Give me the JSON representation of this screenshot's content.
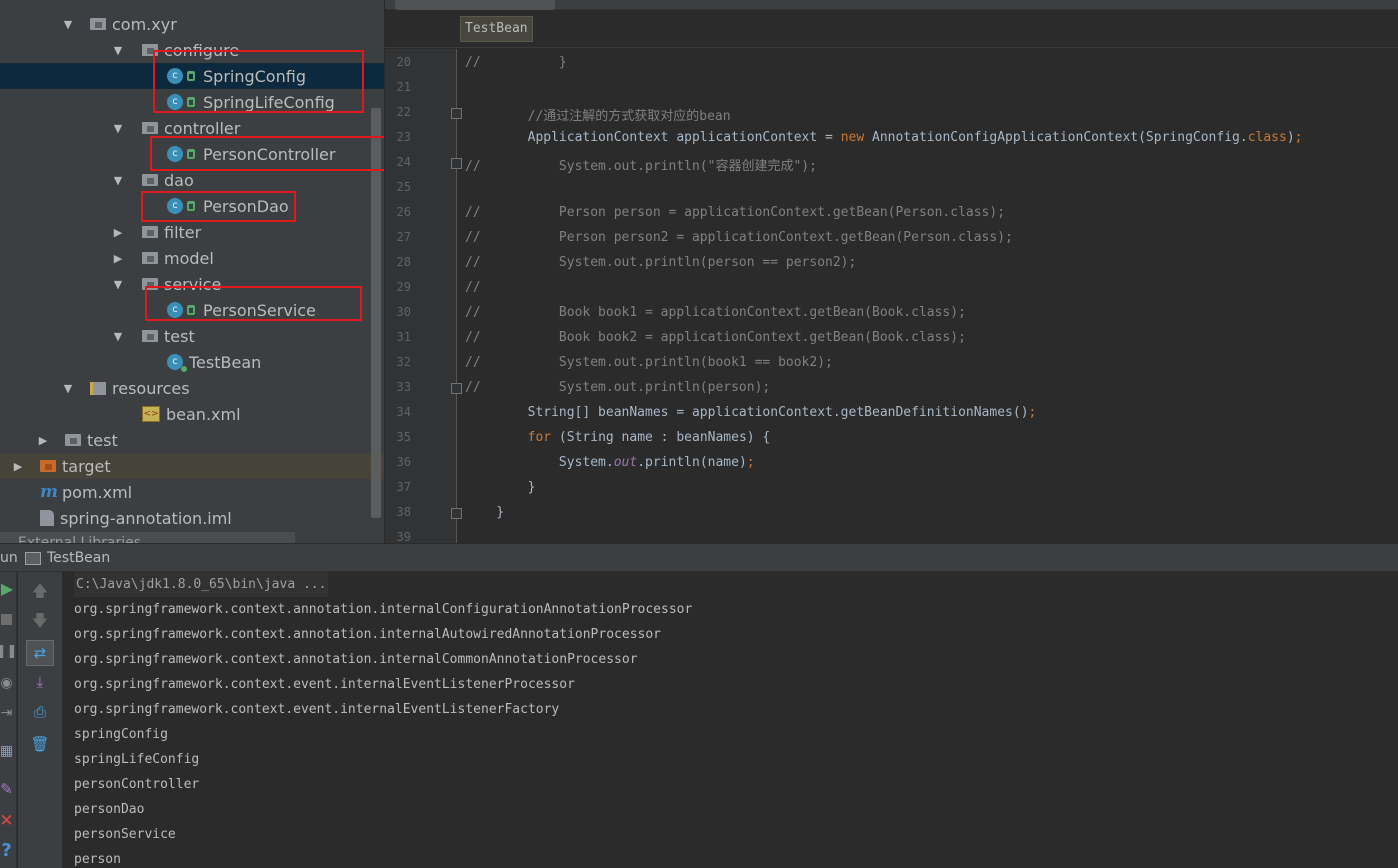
{
  "tree": [
    {
      "label": "com.xyr",
      "icon": "folder",
      "arrow": "▼",
      "indent": 1
    },
    {
      "label": "configure",
      "icon": "folder",
      "arrow": "▼",
      "indent": 2
    },
    {
      "label": "SpringConfig",
      "icon": "class",
      "arrow": "",
      "indent": 3,
      "selected": true
    },
    {
      "label": "SpringLifeConfig",
      "icon": "class",
      "arrow": "",
      "indent": 3
    },
    {
      "label": "controller",
      "icon": "folder",
      "arrow": "▼",
      "indent": 2
    },
    {
      "label": "PersonController",
      "icon": "class",
      "arrow": "",
      "indent": 3
    },
    {
      "label": "dao",
      "icon": "folder",
      "arrow": "▼",
      "indent": 2
    },
    {
      "label": "PersonDao",
      "icon": "class",
      "arrow": "",
      "indent": 3
    },
    {
      "label": "filter",
      "icon": "folder",
      "arrow": "▶",
      "indent": 2
    },
    {
      "label": "model",
      "icon": "folder",
      "arrow": "▶",
      "indent": 2
    },
    {
      "label": "service",
      "icon": "folder",
      "arrow": "▼",
      "indent": 2
    },
    {
      "label": "PersonService",
      "icon": "class",
      "arrow": "",
      "indent": 3
    },
    {
      "label": "test",
      "icon": "folder",
      "arrow": "▼",
      "indent": 2
    },
    {
      "label": "TestBean",
      "icon": "class-run",
      "arrow": "",
      "indent": 3
    },
    {
      "label": "resources",
      "icon": "resources",
      "arrow": "▼",
      "indent": 1
    },
    {
      "label": "bean.xml",
      "icon": "xml",
      "arrow": "",
      "indent": 2
    },
    {
      "label": "test",
      "icon": "folder",
      "arrow": "▶",
      "indent": 0
    },
    {
      "label": "target",
      "icon": "folder-orange",
      "arrow": "▶",
      "indent": -1,
      "alt": true
    },
    {
      "label": "pom.xml",
      "icon": "maven",
      "arrow": "",
      "indent": -1
    },
    {
      "label": "spring-annotation.iml",
      "icon": "iml",
      "arrow": "",
      "indent": -1
    }
  ],
  "external_libraries": "External Libraries",
  "breadcrumb": "TestBean",
  "line_numbers": [
    "20",
    "21",
    "22",
    "23",
    "24",
    "25",
    "26",
    "27",
    "28",
    "29",
    "30",
    "31",
    "32",
    "33",
    "34",
    "35",
    "36",
    "37",
    "38",
    "39"
  ],
  "code": [
    [
      {
        "t": "//          }",
        "c": "cm"
      }
    ],
    [],
    [
      {
        "t": "        //通过注解的方式获取对应的bean",
        "c": "cm"
      }
    ],
    [
      {
        "t": "        ApplicationContext applicationContext = "
      },
      {
        "t": "new",
        "c": "kw"
      },
      {
        "t": " AnnotationConfigApplicationContext(SpringConfig."
      },
      {
        "t": "class",
        "c": "kw"
      },
      {
        "t": ")"
      },
      {
        "t": ";",
        "c": "kw"
      }
    ],
    [
      {
        "t": "//          System.out.println(\"容器创建完成\");",
        "c": "cm"
      }
    ],
    [],
    [
      {
        "t": "//          Person person = applicationContext.getBean(Person.class);",
        "c": "cm"
      }
    ],
    [
      {
        "t": "//          Person person2 = applicationContext.getBean(Person.class);",
        "c": "cm"
      }
    ],
    [
      {
        "t": "//          System.out.println(person == person2);",
        "c": "cm"
      }
    ],
    [
      {
        "t": "//",
        "c": "cm"
      }
    ],
    [
      {
        "t": "//          Book book1 = applicationContext.getBean(Book.class);",
        "c": "cm"
      }
    ],
    [
      {
        "t": "//          Book book2 = applicationContext.getBean(Book.class);",
        "c": "cm"
      }
    ],
    [
      {
        "t": "//          System.out.println(book1 == book2);",
        "c": "cm"
      }
    ],
    [
      {
        "t": "//          System.out.println(person);",
        "c": "cm"
      }
    ],
    [
      {
        "t": "        String[] beanNames = applicationContext.getBeanDefinitionNames()"
      },
      {
        "t": ";",
        "c": "kw"
      }
    ],
    [
      {
        "t": "        "
      },
      {
        "t": "for",
        "c": "kw"
      },
      {
        "t": " (String name : beanNames) {"
      }
    ],
    [
      {
        "t": "            System."
      },
      {
        "t": "out",
        "c": "fld"
      },
      {
        "t": ".println(name)"
      },
      {
        "t": ";",
        "c": "kw"
      }
    ],
    [
      {
        "t": "        }"
      }
    ],
    [
      {
        "t": "    }"
      }
    ],
    []
  ],
  "run": {
    "label": "un",
    "tab": "TestBean",
    "output": [
      "C:\\Java\\jdk1.8.0_65\\bin\\java ...",
      "org.springframework.context.annotation.internalConfigurationAnnotationProcessor",
      "org.springframework.context.annotation.internalAutowiredAnnotationProcessor",
      "org.springframework.context.annotation.internalCommonAnnotationProcessor",
      "org.springframework.context.event.internalEventListenerProcessor",
      "org.springframework.context.event.internalEventListenerFactory",
      "springConfig",
      "springLifeConfig",
      "personController",
      "personDao",
      "personService",
      "person"
    ]
  },
  "toolbar_icons": {
    "left": [
      "run-icon",
      "stop-icon",
      "pause-icon",
      "dump-icon",
      "exit-icon",
      "layout-icon",
      "pin-icon",
      "close-icon",
      "help-icon"
    ],
    "right": [
      "up-arrow-icon",
      "down-arrow-icon",
      "soft-wrap-icon",
      "scroll-to-end-icon",
      "print-icon",
      "trash-icon"
    ]
  }
}
